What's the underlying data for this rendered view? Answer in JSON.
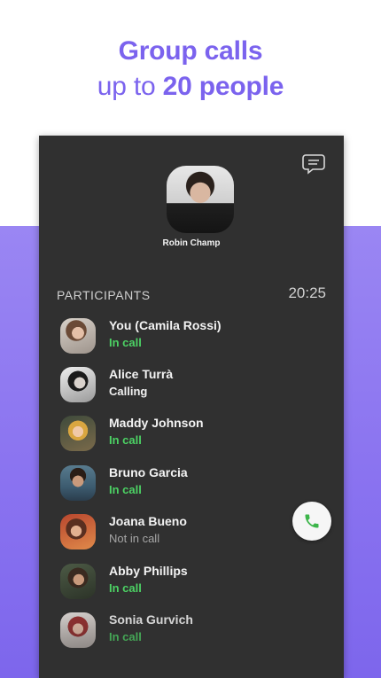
{
  "headline": {
    "line1": "Group calls",
    "line2_prefix": "up to ",
    "line2_bold": "20 people"
  },
  "call": {
    "caller_name": "Robin Champ",
    "section_label": "PARTICIPANTS",
    "timer": "20:25"
  },
  "participants": [
    {
      "name": "You (Camila Rossi)",
      "status": "In call"
    },
    {
      "name": "Alice Turrà",
      "status": "Calling"
    },
    {
      "name": "Maddy Johnson",
      "status": "In call"
    },
    {
      "name": "Bruno Garcia",
      "status": "In call"
    },
    {
      "name": "Joana Bueno",
      "status": "Not in call"
    },
    {
      "name": "Abby Phillips",
      "status": "In call"
    },
    {
      "name": "Sonia Gurvich",
      "status": "In call"
    }
  ],
  "icons": {
    "chat": "chat-bubble-icon",
    "call": "phone-icon"
  },
  "colors": {
    "accent": "#7b63ee",
    "in_call": "#4cd264",
    "panel": "#303030"
  }
}
